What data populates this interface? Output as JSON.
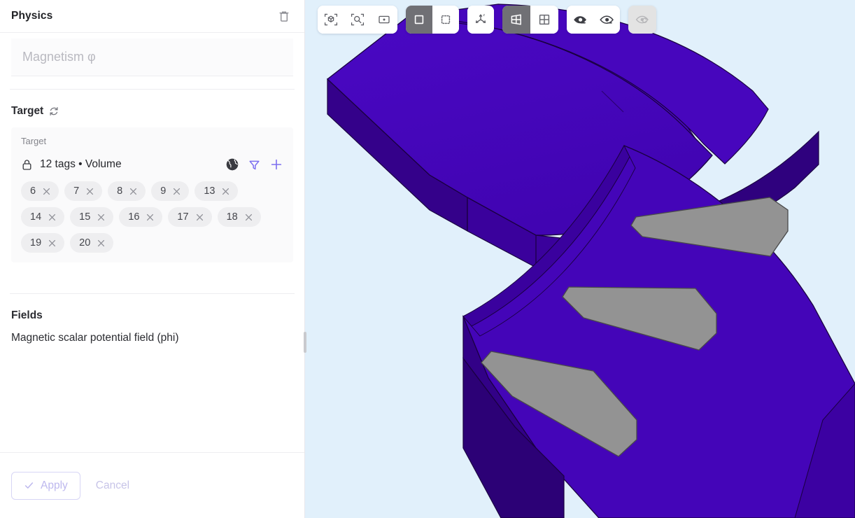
{
  "panel": {
    "title": "Physics",
    "delete_icon": "trash-icon",
    "name_input": {
      "value": "",
      "placeholder": "Magnetism φ"
    },
    "target_section": {
      "heading": "Target",
      "refresh_icon": "refresh-icon",
      "card_label": "Target",
      "lock_icon": "lock-icon",
      "summary": "12 tags • Volume",
      "actions": [
        "globe-icon",
        "filter-icon",
        "plus-icon"
      ],
      "tags": [
        "6",
        "7",
        "8",
        "9",
        "13",
        "14",
        "15",
        "16",
        "17",
        "18",
        "19",
        "20"
      ],
      "tag_remove_icon": "close-icon"
    },
    "fields_section": {
      "heading": "Fields",
      "items": [
        "Magnetic scalar potential field (phi)"
      ]
    },
    "footer": {
      "apply_label": "Apply",
      "apply_icon": "check-icon",
      "cancel_label": "Cancel",
      "apply_disabled": true
    }
  },
  "toolbar": {
    "groups": [
      {
        "name": "view-fit-group",
        "buttons": [
          {
            "name": "fit-to-object-button",
            "icon": "cube-frame-icon",
            "state": "normal"
          },
          {
            "name": "zoom-to-fit-button",
            "icon": "magnifier-frame-icon",
            "state": "normal"
          },
          {
            "name": "zoom-to-window-button",
            "icon": "rect-dot-icon",
            "state": "normal"
          }
        ]
      },
      {
        "name": "selection-mode-group",
        "buttons": [
          {
            "name": "solid-select-button",
            "icon": "square-solid-icon",
            "state": "active"
          },
          {
            "name": "box-select-button",
            "icon": "square-dashed-icon",
            "state": "normal"
          }
        ]
      },
      {
        "name": "axes-group",
        "buttons": [
          {
            "name": "show-axes-button",
            "icon": "axes-icon",
            "state": "normal"
          }
        ]
      },
      {
        "name": "grid-mode-group",
        "buttons": [
          {
            "name": "perspective-grid-button",
            "icon": "grid-perspective-icon",
            "state": "active"
          },
          {
            "name": "flat-grid-button",
            "icon": "grid-flat-icon",
            "state": "normal"
          }
        ]
      },
      {
        "name": "visibility-group",
        "buttons": [
          {
            "name": "show-all-button",
            "icon": "eye-filled-icon",
            "state": "normal"
          },
          {
            "name": "hide-all-button",
            "icon": "eye-outline-icon",
            "state": "normal"
          }
        ]
      },
      {
        "name": "reset-visibility-group",
        "buttons": [
          {
            "name": "reset-visibility-button",
            "icon": "eye-reset-icon",
            "state": "disabled"
          }
        ]
      }
    ]
  },
  "viewport": {
    "name": "3d-model-viewport",
    "background_color": "#e1f0fb",
    "model": {
      "body_color": "#4405b8",
      "body_shadow_color": "#2e0280",
      "body_dark_color": "#230165",
      "magnet_color": "#939393",
      "edge_color": "#1a0140"
    }
  }
}
